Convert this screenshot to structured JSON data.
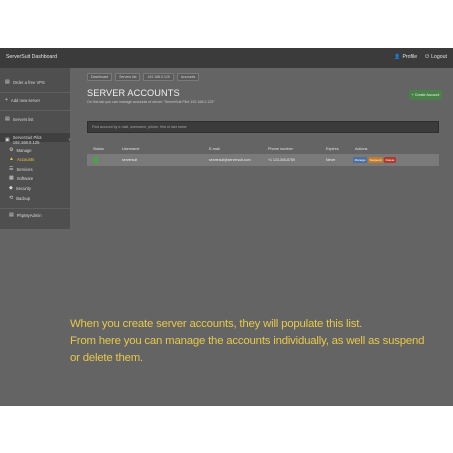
{
  "topbar": {
    "brand": "ServerSuit Dashboard",
    "profile_label": "Profile",
    "logout_label": "Logout"
  },
  "sidebar": {
    "items": [
      {
        "label": "Order a free VPS"
      },
      {
        "label": "Add new server"
      },
      {
        "label": "Servers list"
      }
    ],
    "server_label": "ServerSuit Pilot 192.168.0.125",
    "sub_items": [
      {
        "label": "Manage"
      },
      {
        "label": "Accounts"
      },
      {
        "label": "Services"
      },
      {
        "label": "Software"
      },
      {
        "label": "Security"
      },
      {
        "label": "Backup"
      }
    ],
    "phpmyadmin_label": "PhpMyAdmin"
  },
  "breadcrumbs": [
    "Dashboard",
    "Servers list",
    "192.168.0.125",
    "Accounts"
  ],
  "page": {
    "title": "SERVER ACCOUNTS",
    "subtitle": "On this tab you can manage accounts of server \"ServerSuit Pilot 192.168.0.125\"",
    "create_button": "+ Create Account"
  },
  "search": {
    "placeholder": "Find account by e-mail, username, phone, first or last name"
  },
  "table": {
    "headers": [
      "Status",
      "Username",
      "E-mail",
      "Phone number",
      "Expires",
      "Actions"
    ],
    "rows": [
      {
        "username": "serversuit",
        "email": "serversuit@serversuit.com",
        "phone": "+1 123-345-6789",
        "expires": "Never",
        "actions": [
          "Manage",
          "Suspend",
          "Delete"
        ]
      }
    ]
  },
  "caption": {
    "line1": "When you create server accounts, they will populate this list.",
    "line2": "From here you can manage the accounts individually, as well as suspend",
    "line3": "or delete them."
  },
  "colors": {
    "frame": "#646464",
    "topbar": "#3b3b3b",
    "sidebar": "#4f4f4f",
    "accent_active": "#f0c040",
    "create_button": "#4a7f4a",
    "caption": "#e7c94a"
  }
}
